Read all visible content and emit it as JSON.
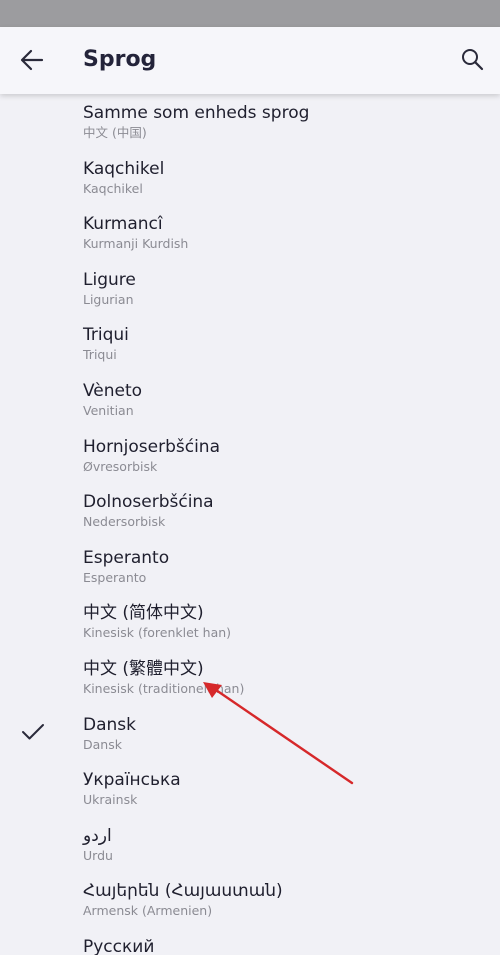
{
  "header": {
    "title": "Sprog",
    "back_icon": "arrow-left-icon",
    "search_icon": "search-icon"
  },
  "colors": {
    "status_bar": "#9c9c9f",
    "background": "#f1f1f6",
    "annotation_arrow": "#d6282a"
  },
  "languages": [
    {
      "name": "Samme som enheds sprog",
      "subtitle": "中文 (中国)",
      "selected": false
    },
    {
      "name": "Kaqchikel",
      "subtitle": "Kaqchikel",
      "selected": false
    },
    {
      "name": "Kurmancî",
      "subtitle": "Kurmanji Kurdish",
      "selected": false
    },
    {
      "name": "Ligure",
      "subtitle": "Ligurian",
      "selected": false
    },
    {
      "name": "Triqui",
      "subtitle": "Triqui",
      "selected": false
    },
    {
      "name": "Vèneto",
      "subtitle": "Venitian",
      "selected": false
    },
    {
      "name": "Hornjoserbšćina",
      "subtitle": "Øvresorbisk",
      "selected": false
    },
    {
      "name": "Dolnoserbšćina",
      "subtitle": "Nedersorbisk",
      "selected": false
    },
    {
      "name": "Esperanto",
      "subtitle": "Esperanto",
      "selected": false
    },
    {
      "name": "中文 (简体中文)",
      "subtitle": "Kinesisk (forenklet han)",
      "selected": false
    },
    {
      "name": "中文 (繁體中文)",
      "subtitle": "Kinesisk (traditionelt han)",
      "selected": false
    },
    {
      "name": "Dansk",
      "subtitle": "Dansk",
      "selected": true
    },
    {
      "name": "Українська",
      "subtitle": "Ukrainsk",
      "selected": false
    },
    {
      "name": "اردو",
      "subtitle": "Urdu",
      "selected": false
    },
    {
      "name": "Հայերեն (Հայաստան)",
      "subtitle": "Armensk (Armenien)",
      "selected": false
    },
    {
      "name": "Русский",
      "subtitle": "",
      "selected": false
    }
  ]
}
